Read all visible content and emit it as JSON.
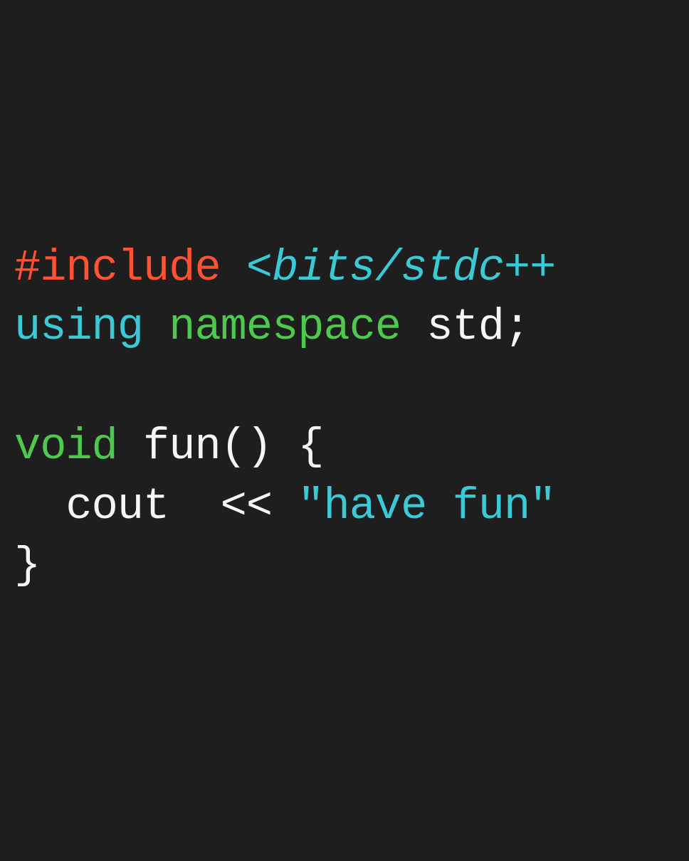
{
  "code": {
    "line1": {
      "preprocessor": "#include",
      "space1": " ",
      "includePath": "<bits/stdc++"
    },
    "line2": {
      "using": "using",
      "space1": " ",
      "namespace": "namespace",
      "space2": " ",
      "std": "std",
      "semicolon": ";"
    },
    "line3": {
      "blank": ""
    },
    "line4": {
      "type": "void",
      "space1": " ",
      "funcname": "fun",
      "parens": "()",
      "space2": " ",
      "brace": "{"
    },
    "line5": {
      "indent": "  ",
      "cout": "cout",
      "space1": "  ",
      "operator": "<<",
      "space2": " ",
      "string": "\"have fun\""
    },
    "line6": {
      "brace": "}"
    }
  }
}
